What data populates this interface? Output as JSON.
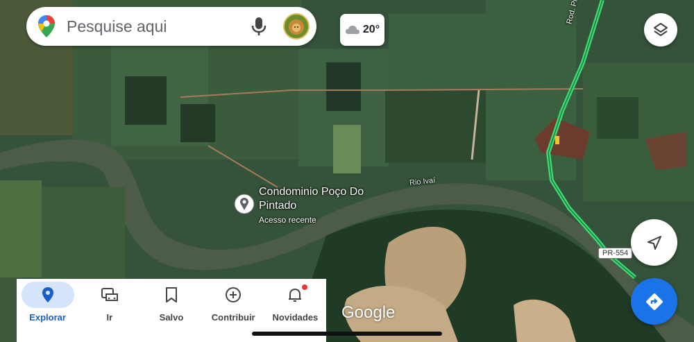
{
  "search": {
    "placeholder": "Pesquise aqui"
  },
  "weather": {
    "temperature": "20°",
    "icon": "cloud-icon"
  },
  "map": {
    "place": {
      "name": "Condominio Poço Do Pintado",
      "subtitle": "Acesso recente"
    },
    "river_label": "Rio Ivaí",
    "road_label": "Rod. Pref. Dr. Hem",
    "route_shield": "PR-554",
    "attribution": "Google",
    "colors": {
      "route": "#3ddc74",
      "field_dark": "#2c4a2e",
      "river": "#4e5f4a"
    }
  },
  "buttons": {
    "layers": "layers-icon",
    "locate": "navigation-arrow-icon",
    "directions": "directions-icon"
  },
  "nav": {
    "items": [
      {
        "label": "Explorar",
        "icon": "location-pin-icon",
        "active": true
      },
      {
        "label": "Ir",
        "icon": "car-icon",
        "active": false
      },
      {
        "label": "Salvo",
        "icon": "bookmark-icon",
        "active": false
      },
      {
        "label": "Contribuir",
        "icon": "add-circle-icon",
        "active": false
      },
      {
        "label": "Novidades",
        "icon": "bell-icon",
        "active": false
      }
    ]
  }
}
